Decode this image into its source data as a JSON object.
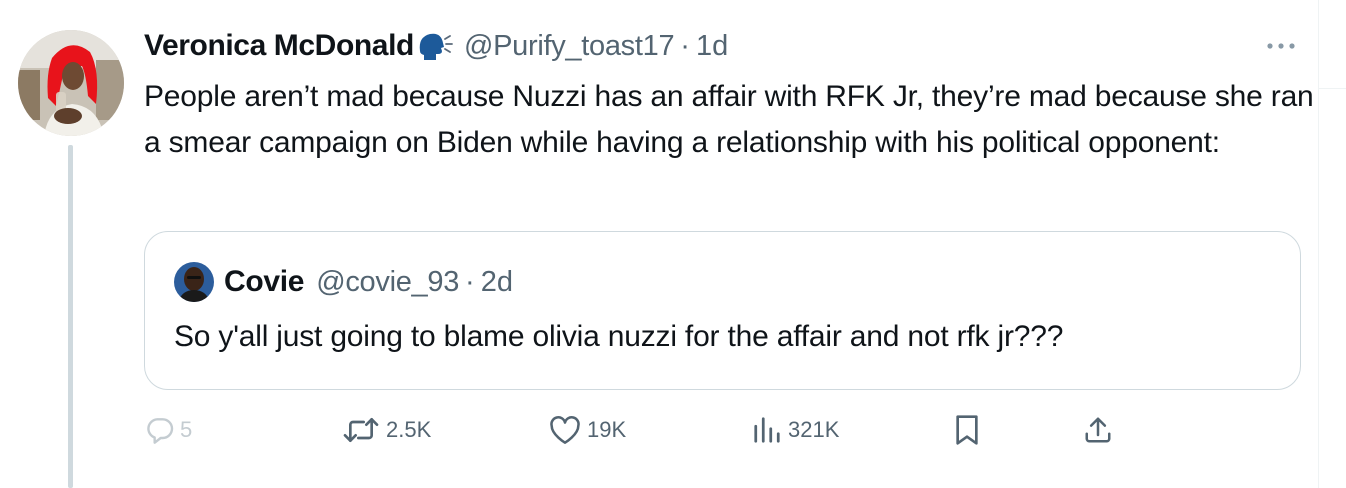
{
  "tweet": {
    "author": {
      "display_name": "Veronica McDonald",
      "handle": "@Purify_toast17",
      "name_emoji": "speaking-head-emoji"
    },
    "separator": "·",
    "time": "1d",
    "text": "People aren’t mad because Nuzzi has an affair with RFK Jr, they’re mad because she ran a smear campaign on Biden while having a relationship with his political opponent:",
    "quote": {
      "display_name": "Covie",
      "handle": "@covie_93",
      "separator": "·",
      "time": "2d",
      "text": "So y'all just going to blame olivia nuzzi for the affair and not rfk jr???"
    },
    "actions": {
      "replies": "5",
      "reposts": "2.5K",
      "likes": "19K",
      "views": "321K"
    }
  },
  "icons": {
    "more": "more-horizontal-icon",
    "reply": "reply-bubble-icon",
    "repost": "repost-arrows-icon",
    "like": "heart-icon",
    "views": "bar-chart-icon",
    "bookmark": "bookmark-icon",
    "share": "share-upload-icon"
  },
  "colors": {
    "text_primary": "#0f1419",
    "text_secondary": "#536471",
    "border": "#cfd9de",
    "thread_line": "#cfd9de",
    "avatar_hair": "#e8131b"
  }
}
